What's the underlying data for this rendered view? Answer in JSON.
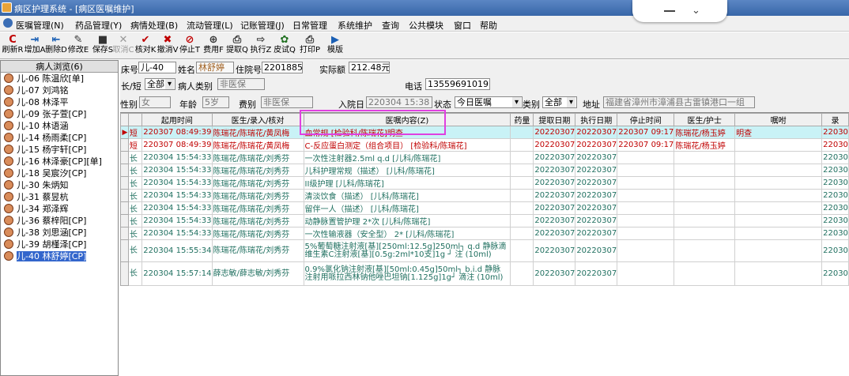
{
  "window": {
    "title": "病区护理系统 - [病区医嘱维护]"
  },
  "menu": [
    "医嘱管理(N)",
    "药品管理(Y)",
    "病情处理(B)",
    "流动管理(L)",
    "记账管理(J)",
    "日常管理",
    "系统维护",
    "查询",
    "公共模块",
    "窗口",
    "帮助"
  ],
  "toolbar": [
    {
      "glyph": "C",
      "label": "刷新R",
      "disabled": false,
      "color": "#c00000"
    },
    {
      "glyph": "⇥",
      "label": "增加A",
      "disabled": false,
      "color": "#1a5fb4"
    },
    {
      "glyph": "⇤",
      "label": "删除D",
      "disabled": false,
      "color": "#1a5fb4"
    },
    {
      "glyph": "✎",
      "label": "修改E",
      "disabled": false,
      "color": "#333"
    },
    {
      "glyph": "■",
      "label": "保存S",
      "disabled": false,
      "color": "#333"
    },
    {
      "glyph": "✕",
      "label": "取消C",
      "disabled": true,
      "color": "#999"
    },
    {
      "glyph": "✔",
      "label": "核对K",
      "disabled": false,
      "color": "#c00000"
    },
    {
      "glyph": "✖",
      "label": "撤消V",
      "disabled": false,
      "color": "#c00000"
    },
    {
      "glyph": "⊘",
      "label": "停止T",
      "disabled": false,
      "color": "#c00000"
    },
    {
      "glyph": "⊕",
      "label": "费用F",
      "disabled": false,
      "color": "#333"
    },
    {
      "glyph": "⎙",
      "label": "提取Q",
      "disabled": false,
      "color": "#333"
    },
    {
      "glyph": "⇨",
      "label": "执行Z",
      "disabled": false,
      "color": "#333"
    },
    {
      "glyph": "✿",
      "label": "皮试Q",
      "disabled": false,
      "color": "#207020"
    },
    {
      "glyph": "⎙",
      "label": "打印P",
      "disabled": false,
      "color": "#333"
    },
    {
      "glyph": "▶",
      "label": "模版",
      "disabled": false,
      "color": "#1a5fb4"
    }
  ],
  "patients": {
    "header": "病人浏览(6)",
    "items": [
      "儿-06 陈温欣[单]",
      "儿-07 刘鸿铭",
      "儿-08 林泽平",
      "儿-09 张子萱[CP]",
      "儿-10 林语涵",
      "儿-14 杨雨柔[CP]",
      "儿-15 杨宇轩[CP]",
      "儿-16 林泽豪[CP][单]",
      "儿-18 吴宸汐[CP]",
      "儿-30 朱炳知",
      "儿-31 蔡昱杭",
      "儿-34 郑泽辉",
      "儿-36 蔡梓阳[CP]",
      "儿-38 刘思涵[CP]",
      "儿-39 胡槿泽[CP]",
      "儿-40 林舒婷[CP]"
    ],
    "selected": 15
  },
  "form": {
    "bed_label": "床号",
    "bed": "儿-40",
    "name_label": "姓名",
    "name": "林舒婷",
    "inpatient_label": "住院号",
    "inpatient": "2201885",
    "balance_label": "实际额",
    "balance": "212.48元",
    "term_label": "长/短",
    "term": "全部",
    "ptype_label": "病人类别",
    "ptype": "非医保",
    "phone_label": "电话",
    "phone": "13559691019",
    "sex_label": "性别",
    "sex": "女",
    "age_label": "年龄",
    "age": "5岁",
    "fee_label": "费别",
    "fee": "非医保",
    "admit_label": "入院日",
    "admit": "220304 15:38",
    "status_label": "状态",
    "status": "今日医嘱",
    "class_label": "类别",
    "class": "全部",
    "addr_label": "地址",
    "addr": "福建省漳州市漳浦县古雷镇港口一组"
  },
  "grid": {
    "headers": [
      "",
      "",
      "起用时间",
      "医生/录入/核对",
      "医嘱内容(Z)",
      "药量",
      "提取日期",
      "执行日期",
      "停止时间",
      "医生/护士",
      "嘱咐",
      "录"
    ],
    "rows": [
      {
        "style": "red sel",
        "ind": "▶",
        "type": "短",
        "start": "220307 08:49:39",
        "doc": "陈瑞花/陈瑞花/黄凤梅",
        "content": "血常规   [检验科/陈瑞花]明查",
        "dose": "",
        "fetch": "20220307",
        "exec": "20220307",
        "stop": "220307 09:17",
        "nurse": "陈瑞花/杨玉婷",
        "note": "明查",
        "rec": "22030"
      },
      {
        "style": "red",
        "ind": "",
        "type": "短",
        "start": "220307 08:49:39",
        "doc": "陈瑞花/陈瑞花/黄凤梅",
        "content": "C-反应蛋白测定（组合项目）    [检验科/陈瑞花]",
        "dose": "",
        "fetch": "20220307",
        "exec": "20220307",
        "stop": "220307 09:17",
        "nurse": "陈瑞花/杨玉婷",
        "note": "",
        "rec": "22030"
      },
      {
        "style": "grn",
        "ind": "",
        "type": "长",
        "start": "220304 15:54:33",
        "doc": "陈瑞花/陈瑞花/刘秀芬",
        "content": "一次性注射器2.5ml q.d [儿科/陈瑞花]",
        "dose": "",
        "fetch": "20220307",
        "exec": "20220307",
        "stop": "",
        "nurse": "",
        "note": "",
        "rec": "22030"
      },
      {
        "style": "grn",
        "ind": "",
        "type": "长",
        "start": "220304 15:54:33",
        "doc": "陈瑞花/陈瑞花/刘秀芬",
        "content": "儿科护理常规（描述）  [儿科/陈瑞花]",
        "dose": "",
        "fetch": "20220307",
        "exec": "20220307",
        "stop": "",
        "nurse": "",
        "note": "",
        "rec": "22030"
      },
      {
        "style": "grn",
        "ind": "",
        "type": "长",
        "start": "220304 15:54:33",
        "doc": "陈瑞花/陈瑞花/刘秀芬",
        "content": "II级护理   [儿科/陈瑞花]",
        "dose": "",
        "fetch": "20220307",
        "exec": "20220307",
        "stop": "",
        "nurse": "",
        "note": "",
        "rec": "22030"
      },
      {
        "style": "grn",
        "ind": "",
        "type": "长",
        "start": "220304 15:54:33",
        "doc": "陈瑞花/陈瑞花/刘秀芬",
        "content": "清淡饮食（描述）  [儿科/陈瑞花]",
        "dose": "",
        "fetch": "20220307",
        "exec": "20220307",
        "stop": "",
        "nurse": "",
        "note": "",
        "rec": "22030"
      },
      {
        "style": "grn",
        "ind": "",
        "type": "长",
        "start": "220304 15:54:33",
        "doc": "陈瑞花/陈瑞花/刘秀芬",
        "content": "留伴一人（描述）  [儿科/陈瑞花]",
        "dose": "",
        "fetch": "20220307",
        "exec": "20220307",
        "stop": "",
        "nurse": "",
        "note": "",
        "rec": "22030"
      },
      {
        "style": "grn",
        "ind": "",
        "type": "长",
        "start": "220304 15:54:33",
        "doc": "陈瑞花/陈瑞花/刘秀芬",
        "content": "动静脉置管护理  2*次  [儿科/陈瑞花]",
        "dose": "",
        "fetch": "20220307",
        "exec": "20220307",
        "stop": "",
        "nurse": "",
        "note": "",
        "rec": "22030"
      },
      {
        "style": "grn",
        "ind": "",
        "type": "长",
        "start": "220304 15:54:33",
        "doc": "陈瑞花/陈瑞花/刘秀芬",
        "content": "一次性输液器（安全型）   2*  [儿科/陈瑞花]",
        "dose": "",
        "fetch": "20220307",
        "exec": "20220307",
        "stop": "",
        "nurse": "",
        "note": "",
        "rec": "22030"
      },
      {
        "style": "grn tall",
        "ind": "",
        "type": "长",
        "start": "220304 15:55:34",
        "doc": "陈瑞花/陈瑞花/刘秀芬",
        "content": "5%葡萄糖注射液[基][250ml:12.5g]250ml┐ q.d 静脉滴\n维生素C注射液[基][0.5g:2ml*10支]1g ┘ 注 (10ml)",
        "dose": "",
        "fetch": "20220307",
        "exec": "20220307",
        "stop": "",
        "nurse": "",
        "note": "",
        "rec": "22030"
      },
      {
        "style": "grn tall2",
        "ind": "",
        "type": "长",
        "start": "220304 15:57:14",
        "doc": "薛志敏/薛志敏/刘秀芬",
        "content": "0.9%氯化钠注射液[基][50ml:0.45g]50ml┐ b.i.d 静脉\n注射用哌拉西林钠他唑巴坦钠[1.125g]1g┘ 滴注 (10ml)",
        "dose": "",
        "fetch": "20220307",
        "exec": "20220307",
        "stop": "",
        "nurse": "",
        "note": "",
        "rec": "22030"
      }
    ]
  }
}
